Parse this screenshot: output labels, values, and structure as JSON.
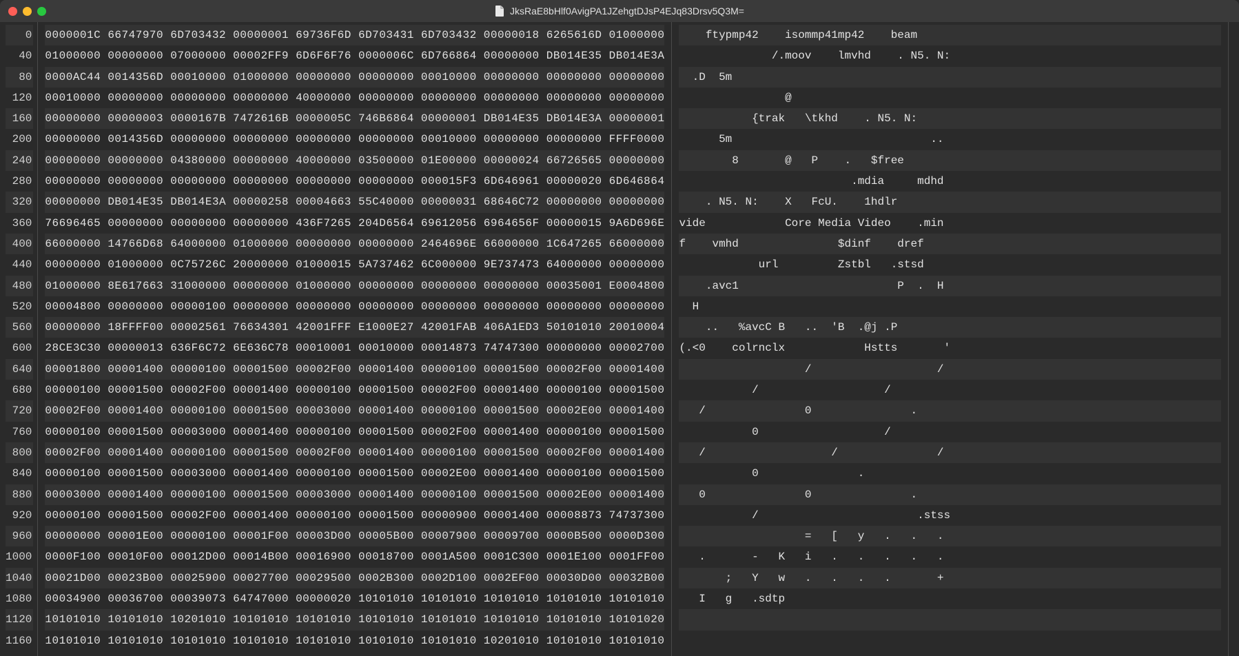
{
  "window": {
    "title": "JksRaE8bHlf0AvigPA1JZehgtDJsP4EJq83Drsv5Q3M=",
    "doc_icon": "document-icon"
  },
  "hex": {
    "offsets": [
      "0",
      "40",
      "80",
      "120",
      "160",
      "200",
      "240",
      "280",
      "320",
      "360",
      "400",
      "440",
      "480",
      "520",
      "560",
      "600",
      "640",
      "680",
      "720",
      "760",
      "800",
      "840",
      "880",
      "920",
      "960",
      "1000",
      "1040",
      "1080",
      "1120",
      "1160"
    ],
    "rows": [
      "0000001C 66747970 6D703432 00000001 69736F6D 6D703431 6D703432 00000018 6265616D 01000000",
      "01000000 00000000 07000000 00002FF9 6D6F6F76 0000006C 6D766864 00000000 DB014E35 DB014E3A",
      "0000AC44 0014356D 00010000 01000000 00000000 00000000 00010000 00000000 00000000 00000000",
      "00010000 00000000 00000000 00000000 40000000 00000000 00000000 00000000 00000000 00000000",
      "00000000 00000003 0000167B 7472616B 0000005C 746B6864 00000001 DB014E35 DB014E3A 00000001",
      "00000000 0014356D 00000000 00000000 00000000 00000000 00010000 00000000 00000000 FFFF0000",
      "00000000 00000000 04380000 00000000 40000000 03500000 01E00000 00000024 66726565 00000000",
      "00000000 00000000 00000000 00000000 00000000 00000000 000015F3 6D646961 00000020 6D646864",
      "00000000 DB014E35 DB014E3A 00000258 00004663 55C40000 00000031 68646C72 00000000 00000000",
      "76696465 00000000 00000000 00000000 436F7265 204D6564 69612056 6964656F 00000015 9A6D696E",
      "66000000 14766D68 64000000 01000000 00000000 00000000 2464696E 66000000 1C647265 66000000",
      "00000000 01000000 0C75726C 20000000 01000015 5A737462 6C000000 9E737473 64000000 00000000",
      "01000000 8E617663 31000000 00000000 01000000 00000000 00000000 00000000 00035001 E0004800",
      "00004800 00000000 00000100 00000000 00000000 00000000 00000000 00000000 00000000 00000000",
      "00000000 18FFFF00 00002561 76634301 42001FFF E1000E27 42001FAB 406A1ED3 50101010 20010004",
      "28CE3C30 00000013 636F6C72 6E636C78 00010001 00010000 00014873 74747300 00000000 00002700",
      "00001800 00001400 00000100 00001500 00002F00 00001400 00000100 00001500 00002F00 00001400",
      "00000100 00001500 00002F00 00001400 00000100 00001500 00002F00 00001400 00000100 00001500",
      "00002F00 00001400 00000100 00001500 00003000 00001400 00000100 00001500 00002E00 00001400",
      "00000100 00001500 00003000 00001400 00000100 00001500 00002F00 00001400 00000100 00001500",
      "00002F00 00001400 00000100 00001500 00002F00 00001400 00000100 00001500 00002F00 00001400",
      "00000100 00001500 00003000 00001400 00000100 00001500 00002E00 00001400 00000100 00001500",
      "00003000 00001400 00000100 00001500 00003000 00001400 00000100 00001500 00002E00 00001400",
      "00000100 00001500 00002F00 00001400 00000100 00001500 00000900 00001400 00008873 74737300",
      "00000000 00001E00 00000100 00001F00 00003D00 00005B00 00007900 00009700 0000B500 0000D300",
      "0000F100 00010F00 00012D00 00014B00 00016900 00018700 0001A500 0001C300 0001E100 0001FF00",
      "00021D00 00023B00 00025900 00027700 00029500 0002B300 0002D100 0002EF00 00030D00 00032B00",
      "00034900 00036700 00039073 64747000 00000020 10101010 10101010 10101010 10101010 10101010",
      "10101010 10101010 10201010 10101010 10101010 10101010 10101010 10101010 10101010 10101020",
      "10101010 10101010 10101010 10101010 10101010 10101010 10101010 10201010 10101010 10101010"
    ]
  },
  "ascii": {
    "rows": [
      "    ftypmp42    isommp41mp42    beam    ",
      "              /.moov    lmvhd    . N5. N:",
      "  .D  5m                                 ",
      "                @                        ",
      "           {trak   \\tkhd    . N5. N:    ",
      "      5m                              .. ",
      "        8       @   P    .   $free       ",
      "                          .mdia     mdhd ",
      "    . N5. N:    X   FcU.    1hdlr        ",
      "vide            Core Media Video    .min ",
      "f    vmhd               $dinf    dref    ",
      "            url         Zstbl   .stsd    ",
      "    .avc1                        P  .  H ",
      "  H                                      ",
      "    ..   %avcC B   ..  'B  .@j .P        ",
      "(.<0    colrnclx            Hstts       '",
      "                   /                   / ",
      "           /                   /         ",
      "   /               0               .     ",
      "           0                   /         ",
      "   /                   /               / ",
      "           0               .             ",
      "   0               0               .     ",
      "           /                        .stss",
      "                   =   [   y   .   .   . ",
      "   .       -   K   i   .   .   .   .   . ",
      "       ;   Y   w   .   .   .   .       + ",
      "   I   g   .sdtp                         ",
      "                                         ",
      "                                         "
    ]
  }
}
